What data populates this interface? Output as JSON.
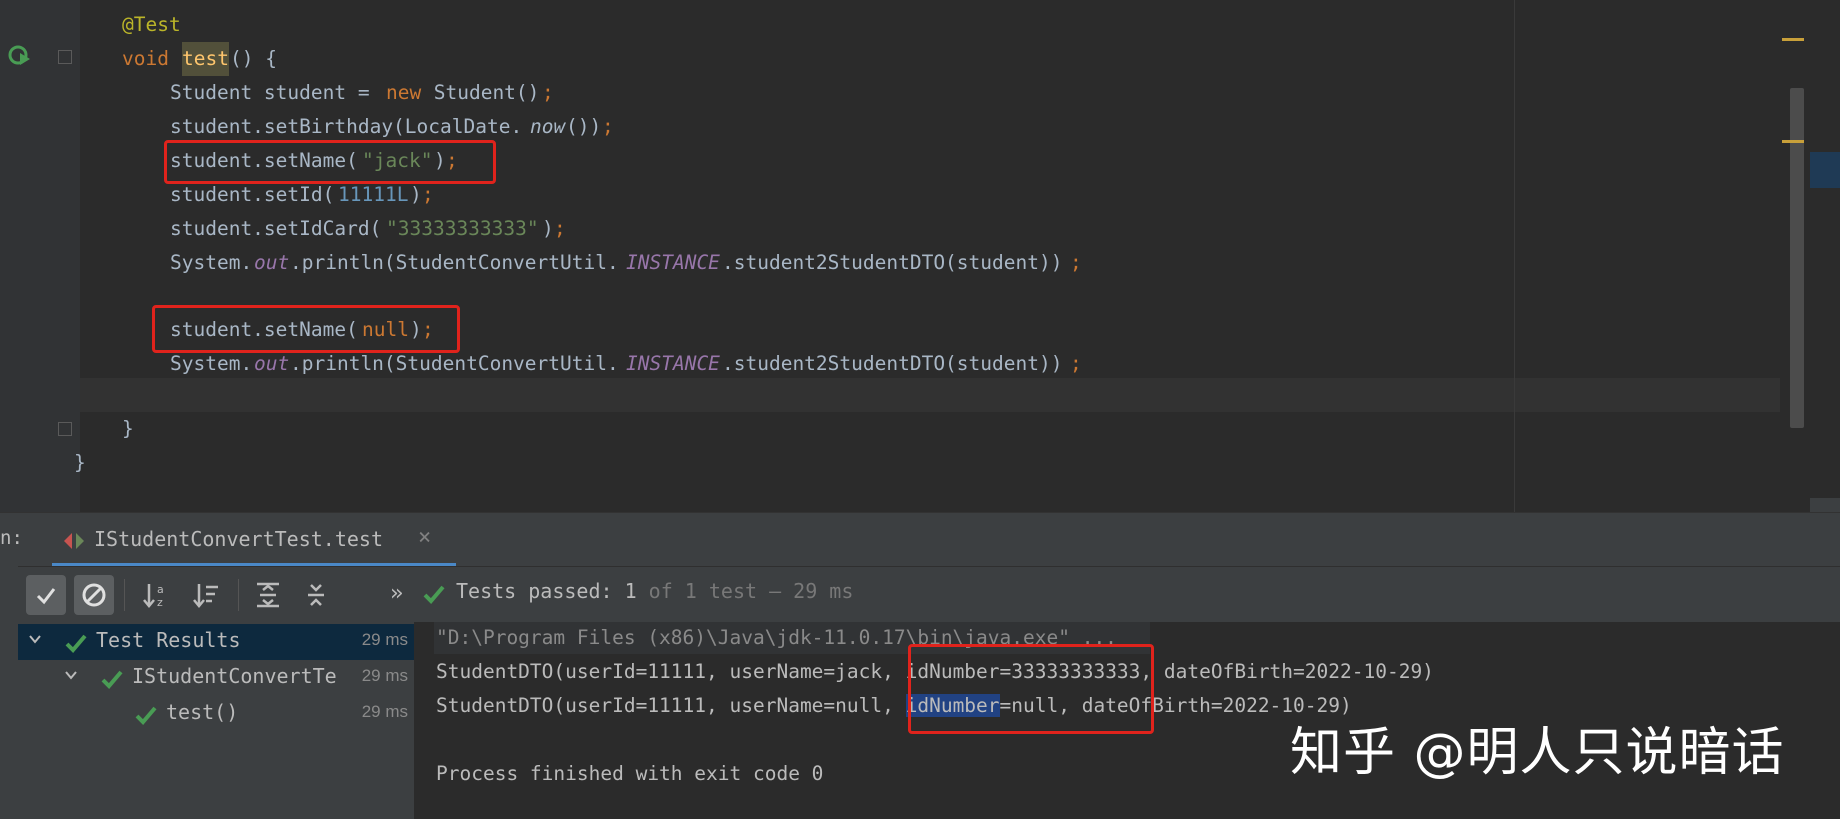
{
  "editor": {
    "lines": {
      "annotation": "@Test",
      "method_kw": "void",
      "method_name": "test",
      "method_rest": "() {",
      "l1_a": "Student student = ",
      "l1_new": "new",
      "l1_b": " Student()",
      "l2_a": "student.setBirthday(LocalDate.",
      "l2_now": "now",
      "l2_b": "())",
      "l3_a": "student.setName(",
      "l3_str": "\"jack\"",
      "l3_b": ")",
      "l4_a": "student.setId(",
      "l4_num": "11111L",
      "l4_b": ")",
      "l5_a": "student.setIdCard(",
      "l5_str": "\"33333333333\"",
      "l5_b": ")",
      "l6_a": "System.",
      "l6_out": "out",
      "l6_b": ".println(StudentConvertUtil.",
      "l6_inst": "INSTANCE",
      "l6_c": ".student2StudentDTO(student))",
      "l7_a": "student.setName(",
      "l7_null": "null",
      "l7_b": ")",
      "semi": ";",
      "close_method": "}",
      "close_class": "}"
    }
  },
  "run_panel": {
    "label": "n:",
    "tab_label": "IStudentConvertTest.test",
    "tab_close": "×",
    "chevron": "»",
    "status_main": "Tests passed: ",
    "status_count": "1",
    "status_rest": " of 1 test – 29 ms"
  },
  "tree": {
    "rows": [
      {
        "name": "Test Results",
        "time": "29 ms"
      },
      {
        "name": "IStudentConvertTe",
        "time": "29 ms"
      },
      {
        "name": "test()",
        "time": "29 ms"
      }
    ]
  },
  "console": {
    "command": "\"D:\\Program Files (x86)\\Java\\jdk-11.0.17\\bin\\java.exe\" ...",
    "out1_a": "StudentDTO(userId=11111, userName=jack, ",
    "out1_b": "idNumber=33333333333",
    "out1_c": ", dateOfBirth=2022-10-29)",
    "out2_a": "StudentDTO(userId=11111, userName=null, ",
    "out2_sel": "idNumber",
    "out2_b": "=null",
    "out2_c": ", dateOfBirth=2022-10-29)",
    "finished": "Process finished with exit code 0"
  },
  "watermark": "知乎 @明人只说暗话",
  "colors": {
    "background": "#2b2b2b",
    "keyword": "#cc7832",
    "string": "#6a8759",
    "number": "#6897bb",
    "highlight_box": "#e0231c",
    "pass_green": "#499c54"
  }
}
